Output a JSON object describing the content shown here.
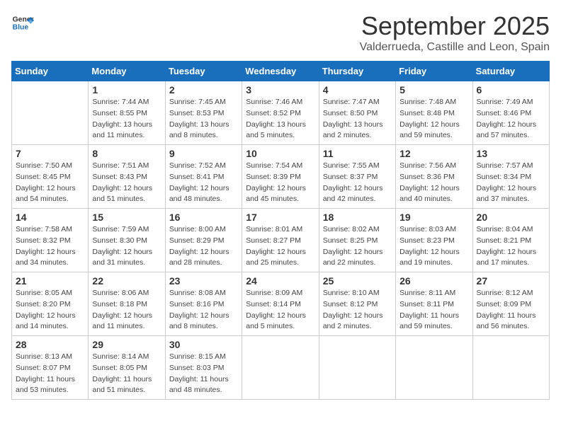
{
  "logo": {
    "general": "General",
    "blue": "Blue"
  },
  "title": "September 2025",
  "subtitle": "Valderrueda, Castille and Leon, Spain",
  "days_of_week": [
    "Sunday",
    "Monday",
    "Tuesday",
    "Wednesday",
    "Thursday",
    "Friday",
    "Saturday"
  ],
  "weeks": [
    [
      {
        "day": "",
        "sunrise": "",
        "sunset": "",
        "daylight": ""
      },
      {
        "day": "1",
        "sunrise": "Sunrise: 7:44 AM",
        "sunset": "Sunset: 8:55 PM",
        "daylight": "Daylight: 13 hours and 11 minutes."
      },
      {
        "day": "2",
        "sunrise": "Sunrise: 7:45 AM",
        "sunset": "Sunset: 8:53 PM",
        "daylight": "Daylight: 13 hours and 8 minutes."
      },
      {
        "day": "3",
        "sunrise": "Sunrise: 7:46 AM",
        "sunset": "Sunset: 8:52 PM",
        "daylight": "Daylight: 13 hours and 5 minutes."
      },
      {
        "day": "4",
        "sunrise": "Sunrise: 7:47 AM",
        "sunset": "Sunset: 8:50 PM",
        "daylight": "Daylight: 13 hours and 2 minutes."
      },
      {
        "day": "5",
        "sunrise": "Sunrise: 7:48 AM",
        "sunset": "Sunset: 8:48 PM",
        "daylight": "Daylight: 12 hours and 59 minutes."
      },
      {
        "day": "6",
        "sunrise": "Sunrise: 7:49 AM",
        "sunset": "Sunset: 8:46 PM",
        "daylight": "Daylight: 12 hours and 57 minutes."
      }
    ],
    [
      {
        "day": "7",
        "sunrise": "Sunrise: 7:50 AM",
        "sunset": "Sunset: 8:45 PM",
        "daylight": "Daylight: 12 hours and 54 minutes."
      },
      {
        "day": "8",
        "sunrise": "Sunrise: 7:51 AM",
        "sunset": "Sunset: 8:43 PM",
        "daylight": "Daylight: 12 hours and 51 minutes."
      },
      {
        "day": "9",
        "sunrise": "Sunrise: 7:52 AM",
        "sunset": "Sunset: 8:41 PM",
        "daylight": "Daylight: 12 hours and 48 minutes."
      },
      {
        "day": "10",
        "sunrise": "Sunrise: 7:54 AM",
        "sunset": "Sunset: 8:39 PM",
        "daylight": "Daylight: 12 hours and 45 minutes."
      },
      {
        "day": "11",
        "sunrise": "Sunrise: 7:55 AM",
        "sunset": "Sunset: 8:37 PM",
        "daylight": "Daylight: 12 hours and 42 minutes."
      },
      {
        "day": "12",
        "sunrise": "Sunrise: 7:56 AM",
        "sunset": "Sunset: 8:36 PM",
        "daylight": "Daylight: 12 hours and 40 minutes."
      },
      {
        "day": "13",
        "sunrise": "Sunrise: 7:57 AM",
        "sunset": "Sunset: 8:34 PM",
        "daylight": "Daylight: 12 hours and 37 minutes."
      }
    ],
    [
      {
        "day": "14",
        "sunrise": "Sunrise: 7:58 AM",
        "sunset": "Sunset: 8:32 PM",
        "daylight": "Daylight: 12 hours and 34 minutes."
      },
      {
        "day": "15",
        "sunrise": "Sunrise: 7:59 AM",
        "sunset": "Sunset: 8:30 PM",
        "daylight": "Daylight: 12 hours and 31 minutes."
      },
      {
        "day": "16",
        "sunrise": "Sunrise: 8:00 AM",
        "sunset": "Sunset: 8:29 PM",
        "daylight": "Daylight: 12 hours and 28 minutes."
      },
      {
        "day": "17",
        "sunrise": "Sunrise: 8:01 AM",
        "sunset": "Sunset: 8:27 PM",
        "daylight": "Daylight: 12 hours and 25 minutes."
      },
      {
        "day": "18",
        "sunrise": "Sunrise: 8:02 AM",
        "sunset": "Sunset: 8:25 PM",
        "daylight": "Daylight: 12 hours and 22 minutes."
      },
      {
        "day": "19",
        "sunrise": "Sunrise: 8:03 AM",
        "sunset": "Sunset: 8:23 PM",
        "daylight": "Daylight: 12 hours and 19 minutes."
      },
      {
        "day": "20",
        "sunrise": "Sunrise: 8:04 AM",
        "sunset": "Sunset: 8:21 PM",
        "daylight": "Daylight: 12 hours and 17 minutes."
      }
    ],
    [
      {
        "day": "21",
        "sunrise": "Sunrise: 8:05 AM",
        "sunset": "Sunset: 8:20 PM",
        "daylight": "Daylight: 12 hours and 14 minutes."
      },
      {
        "day": "22",
        "sunrise": "Sunrise: 8:06 AM",
        "sunset": "Sunset: 8:18 PM",
        "daylight": "Daylight: 12 hours and 11 minutes."
      },
      {
        "day": "23",
        "sunrise": "Sunrise: 8:08 AM",
        "sunset": "Sunset: 8:16 PM",
        "daylight": "Daylight: 12 hours and 8 minutes."
      },
      {
        "day": "24",
        "sunrise": "Sunrise: 8:09 AM",
        "sunset": "Sunset: 8:14 PM",
        "daylight": "Daylight: 12 hours and 5 minutes."
      },
      {
        "day": "25",
        "sunrise": "Sunrise: 8:10 AM",
        "sunset": "Sunset: 8:12 PM",
        "daylight": "Daylight: 12 hours and 2 minutes."
      },
      {
        "day": "26",
        "sunrise": "Sunrise: 8:11 AM",
        "sunset": "Sunset: 8:11 PM",
        "daylight": "Daylight: 11 hours and 59 minutes."
      },
      {
        "day": "27",
        "sunrise": "Sunrise: 8:12 AM",
        "sunset": "Sunset: 8:09 PM",
        "daylight": "Daylight: 11 hours and 56 minutes."
      }
    ],
    [
      {
        "day": "28",
        "sunrise": "Sunrise: 8:13 AM",
        "sunset": "Sunset: 8:07 PM",
        "daylight": "Daylight: 11 hours and 53 minutes."
      },
      {
        "day": "29",
        "sunrise": "Sunrise: 8:14 AM",
        "sunset": "Sunset: 8:05 PM",
        "daylight": "Daylight: 11 hours and 51 minutes."
      },
      {
        "day": "30",
        "sunrise": "Sunrise: 8:15 AM",
        "sunset": "Sunset: 8:03 PM",
        "daylight": "Daylight: 11 hours and 48 minutes."
      },
      {
        "day": "",
        "sunrise": "",
        "sunset": "",
        "daylight": ""
      },
      {
        "day": "",
        "sunrise": "",
        "sunset": "",
        "daylight": ""
      },
      {
        "day": "",
        "sunrise": "",
        "sunset": "",
        "daylight": ""
      },
      {
        "day": "",
        "sunrise": "",
        "sunset": "",
        "daylight": ""
      }
    ]
  ]
}
